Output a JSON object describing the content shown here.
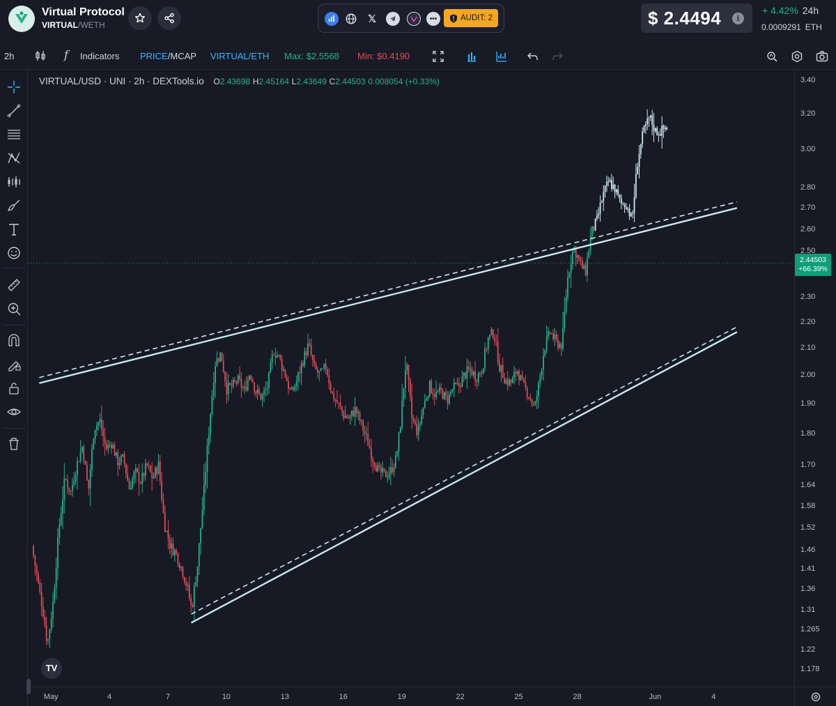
{
  "header": {
    "token_name": "Virtual Protocol",
    "pair_base": "VIRTUAL",
    "pair_sep": "/",
    "pair_quote": "WETH",
    "audit_label": "AUDIT: 2",
    "price": "$ 2.4494",
    "change_pct": "+ 4.42%",
    "change_period": "24h",
    "eth_price": "0.0009291",
    "eth_unit": "ETH",
    "social_icons": [
      "dextools-chart-icon",
      "globe-icon",
      "x-icon",
      "telegram-icon",
      "virtual-icon",
      "more-icon"
    ],
    "more_glyph": "•••",
    "x_glyph": "𝕏"
  },
  "toolbar": {
    "interval": "2h",
    "fx_glyph": "f",
    "indicators": "Indicators",
    "price_label": "PRICE",
    "price_sep": "/",
    "mcap_label": "MCAP",
    "virtual_eth": "VIRTUAL/ETH",
    "max": "Max: $2.5568",
    "min": "Min: $0.4190"
  },
  "legend": {
    "symbol": "VIRTUAL/USD · UNI · 2h · DEXTools.io",
    "o_key": "O",
    "o_val": "2.43698",
    "h_key": "H",
    "h_val": "2.45164",
    "l_key": "L",
    "l_val": "2.43649",
    "c_key": "C",
    "c_val": "2.44503",
    "change": "0.008054 (+0.33%)"
  },
  "last_price_tag": {
    "price": "2.44503",
    "pct": "+66.39%"
  },
  "tv_logo": "TV",
  "colors": {
    "up": "#27b08c",
    "down": "#e04a55",
    "after_break": "#cfe8f2",
    "trendline": "#c8eaf2",
    "accent_blue": "#3bb4ff",
    "audit": "#f5a623"
  },
  "chart_data": {
    "type": "candlestick",
    "pair": "VIRTUAL/USD",
    "interval": "2h",
    "y_scale": "log",
    "ylim": [
      1.16,
      3.42
    ],
    "yticks": [
      "3.40",
      "3.20",
      "3.00",
      "2.80",
      "2.70",
      "2.60",
      "2.50",
      "2.30",
      "2.20",
      "2.10",
      "2.00",
      "1.90",
      "1.80",
      "1.70",
      "1.64",
      "1.58",
      "1.52",
      "1.46",
      "1.41",
      "1.36",
      "1.31",
      "1.265",
      "1.22",
      "1.178"
    ],
    "xticks": [
      {
        "label": "May",
        "day": 1
      },
      {
        "label": "4",
        "day": 4
      },
      {
        "label": "7",
        "day": 7
      },
      {
        "label": "10",
        "day": 10
      },
      {
        "label": "13",
        "day": 13
      },
      {
        "label": "16",
        "day": 16
      },
      {
        "label": "19",
        "day": 19
      },
      {
        "label": "22",
        "day": 22
      },
      {
        "label": "25",
        "day": 25
      },
      {
        "label": "28",
        "day": 28
      },
      {
        "label": "Jun",
        "day": 32
      },
      {
        "label": "4",
        "day": 35
      }
    ],
    "x_range_days": [
      0.1,
      38.85
    ],
    "price_path": [
      [
        0.1,
        1.47
      ],
      [
        0.4,
        1.38
      ],
      [
        0.7,
        1.3
      ],
      [
        0.9,
        1.23
      ],
      [
        1.2,
        1.33
      ],
      [
        1.5,
        1.52
      ],
      [
        1.8,
        1.66
      ],
      [
        2.1,
        1.62
      ],
      [
        2.4,
        1.7
      ],
      [
        2.7,
        1.76
      ],
      [
        3.0,
        1.62
      ],
      [
        3.3,
        1.82
      ],
      [
        3.6,
        1.84
      ],
      [
        3.9,
        1.75
      ],
      [
        4.2,
        1.77
      ],
      [
        4.5,
        1.71
      ],
      [
        4.8,
        1.72
      ],
      [
        5.1,
        1.63
      ],
      [
        5.4,
        1.68
      ],
      [
        5.7,
        1.65
      ],
      [
        6.0,
        1.7
      ],
      [
        6.3,
        1.66
      ],
      [
        6.6,
        1.7
      ],
      [
        6.9,
        1.53
      ],
      [
        7.2,
        1.47
      ],
      [
        7.5,
        1.45
      ],
      [
        7.8,
        1.41
      ],
      [
        8.1,
        1.36
      ],
      [
        8.3,
        1.31
      ],
      [
        8.6,
        1.42
      ],
      [
        8.9,
        1.6
      ],
      [
        9.2,
        1.82
      ],
      [
        9.5,
        2.04
      ],
      [
        9.8,
        2.08
      ],
      [
        10.1,
        1.95
      ],
      [
        10.4,
        1.96
      ],
      [
        10.7,
        1.98
      ],
      [
        11.0,
        1.94
      ],
      [
        11.3,
        2.01
      ],
      [
        11.6,
        1.94
      ],
      [
        11.9,
        1.92
      ],
      [
        12.2,
        1.96
      ],
      [
        12.5,
        2.09
      ],
      [
        12.8,
        2.06
      ],
      [
        13.1,
        2.0
      ],
      [
        13.4,
        1.93
      ],
      [
        13.7,
        1.98
      ],
      [
        14.0,
        2.05
      ],
      [
        14.3,
        2.11
      ],
      [
        14.6,
        2.02
      ],
      [
        14.9,
        2.0
      ],
      [
        15.2,
        2.03
      ],
      [
        15.5,
        1.93
      ],
      [
        15.8,
        1.9
      ],
      [
        16.1,
        1.86
      ],
      [
        16.4,
        1.85
      ],
      [
        16.7,
        1.88
      ],
      [
        17.0,
        1.83
      ],
      [
        17.3,
        1.78
      ],
      [
        17.6,
        1.72
      ],
      [
        17.9,
        1.68
      ],
      [
        18.2,
        1.67
      ],
      [
        18.5,
        1.68
      ],
      [
        18.8,
        1.72
      ],
      [
        19.0,
        1.82
      ],
      [
        19.3,
        2.05
      ],
      [
        19.6,
        1.85
      ],
      [
        19.9,
        1.8
      ],
      [
        20.2,
        1.89
      ],
      [
        20.5,
        1.96
      ],
      [
        20.8,
        1.93
      ],
      [
        21.1,
        1.94
      ],
      [
        21.4,
        1.91
      ],
      [
        21.7,
        1.95
      ],
      [
        22.0,
        1.96
      ],
      [
        22.3,
        2.0
      ],
      [
        22.6,
        2.02
      ],
      [
        22.9,
        1.99
      ],
      [
        23.2,
        2.02
      ],
      [
        23.5,
        2.13
      ],
      [
        23.8,
        2.16
      ],
      [
        24.1,
        2.03
      ],
      [
        24.4,
        1.98
      ],
      [
        24.7,
        1.97
      ],
      [
        25.0,
        2.02
      ],
      [
        25.3,
        1.96
      ],
      [
        25.6,
        1.93
      ],
      [
        25.9,
        1.88
      ],
      [
        26.1,
        1.96
      ],
      [
        26.4,
        2.1
      ],
      [
        26.7,
        2.16
      ],
      [
        27.0,
        2.12
      ],
      [
        27.3,
        2.11
      ],
      [
        27.6,
        2.38
      ],
      [
        27.9,
        2.52
      ],
      [
        28.2,
        2.45
      ],
      [
        28.5,
        2.4
      ],
      [
        28.8,
        2.58
      ],
      [
        29.1,
        2.64
      ],
      [
        29.4,
        2.76
      ],
      [
        29.7,
        2.83
      ],
      [
        30.0,
        2.8
      ],
      [
        30.3,
        2.72
      ],
      [
        30.6,
        2.72
      ],
      [
        30.9,
        2.64
      ],
      [
        31.2,
        2.95
      ],
      [
        31.5,
        3.1
      ],
      [
        31.8,
        3.18
      ],
      [
        32.1,
        3.1
      ],
      [
        32.4,
        3.1
      ],
      [
        32.6,
        3.12
      ]
    ],
    "trendlines": [
      {
        "role": "upper",
        "style": "solid",
        "p1": [
          0.4,
          1.97
        ],
        "p2": [
          36.2,
          2.7
        ]
      },
      {
        "role": "upper",
        "style": "dashed",
        "p1": [
          0.4,
          1.99
        ],
        "p2": [
          36.2,
          2.73
        ]
      },
      {
        "role": "lower",
        "style": "solid",
        "p1": [
          8.2,
          1.28
        ],
        "p2": [
          36.2,
          2.16
        ]
      },
      {
        "role": "lower",
        "style": "dashed",
        "p1": [
          8.2,
          1.3
        ],
        "p2": [
          36.2,
          2.18
        ]
      }
    ],
    "breakout_day": 28.9,
    "last_price": 2.44503
  }
}
